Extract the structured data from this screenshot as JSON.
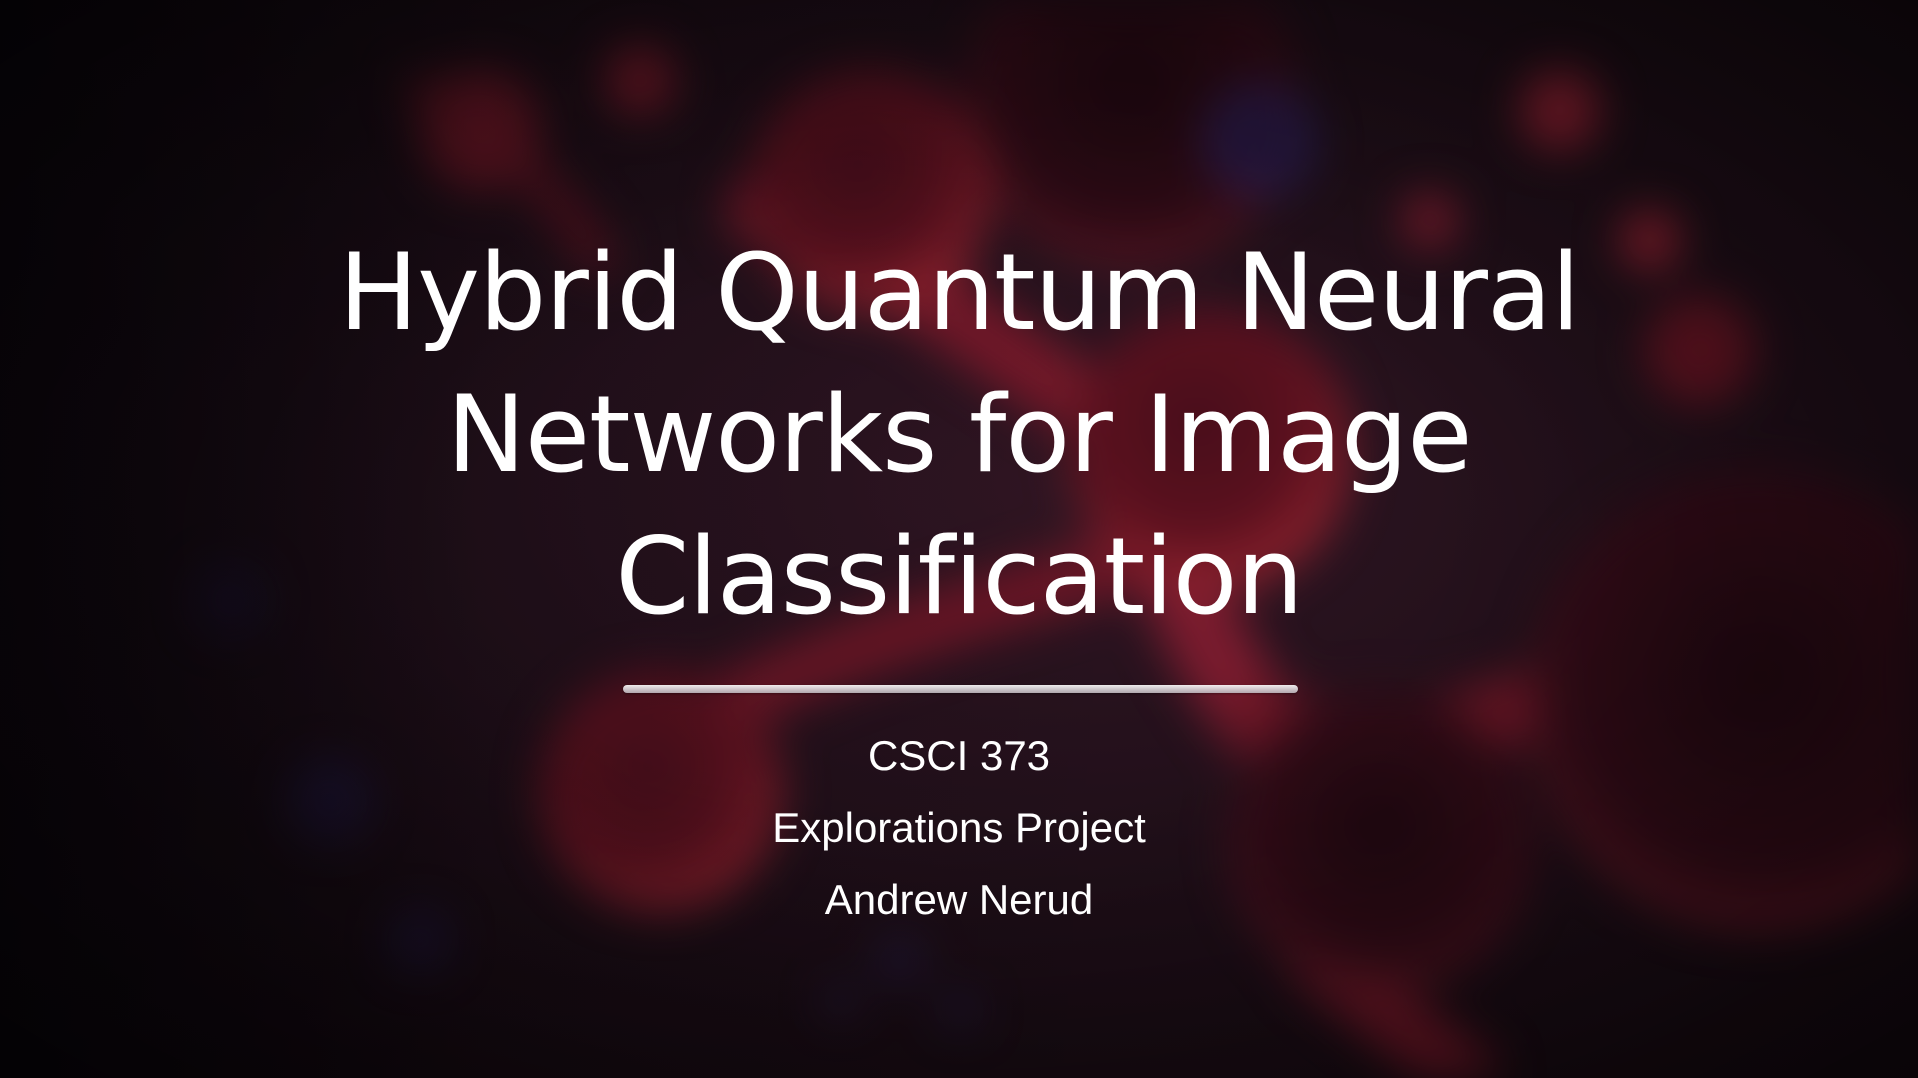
{
  "slide": {
    "title": "Hybrid Quantum Neural Networks for Image Classification",
    "subtitle_lines": [
      "CSCI 373",
      "Explorations Project",
      "Andrew Nerud"
    ]
  },
  "colors": {
    "background": "#24111c",
    "accent_red": "#c8233a",
    "accent_blue": "#3a3cc8",
    "text": "#ffffff",
    "divider": "#d9d4d8"
  },
  "background_image": "blurred-molecule-illustration"
}
